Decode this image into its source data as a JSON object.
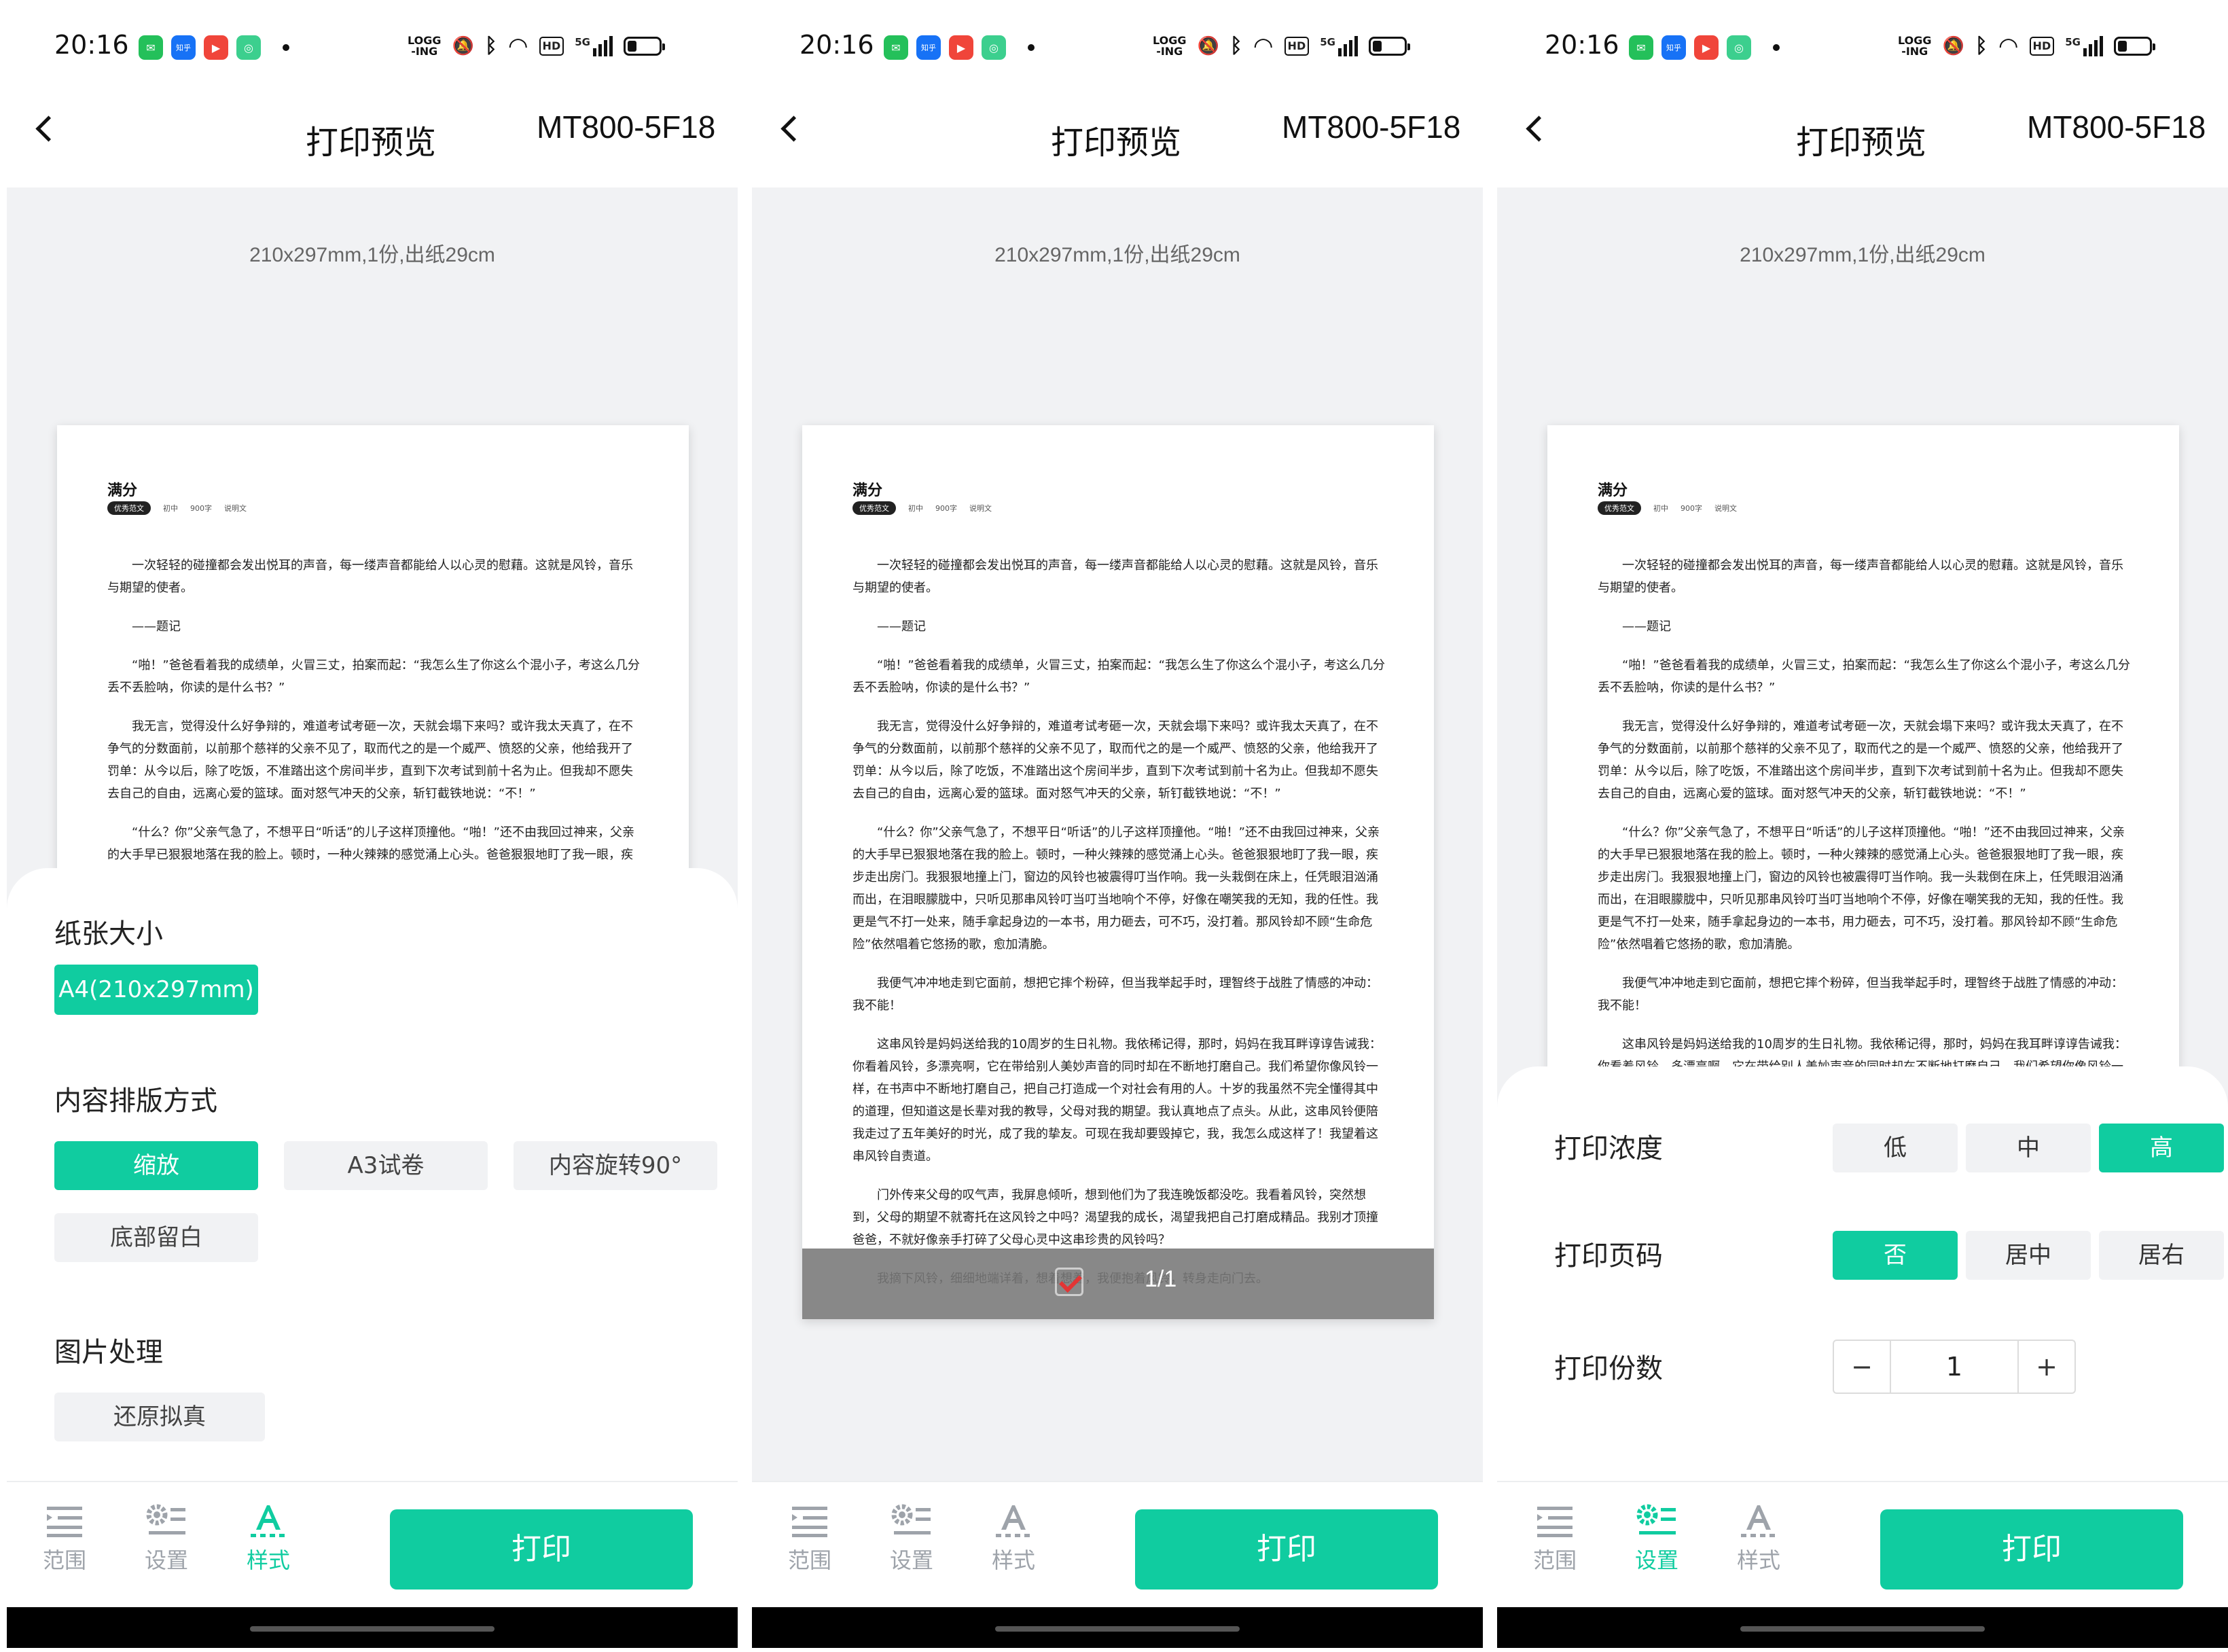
{
  "status_bar": {
    "time": "20:16",
    "app_icons": [
      {
        "name": "message-app-icon",
        "color": "#24c05a",
        "glyph": "✉"
      },
      {
        "name": "zhihu-app-icon",
        "color": "#1772f6",
        "glyph": "知乎"
      },
      {
        "name": "video-app-icon",
        "color": "#f0453a",
        "glyph": "▶"
      },
      {
        "name": "green-app-icon",
        "color": "#3ccf8e",
        "glyph": "◎"
      }
    ],
    "log_label": "LOGG\n-ING",
    "hd_label": "HD",
    "network_label": "5G",
    "battery_percent": 30
  },
  "header": {
    "title": "打印预览",
    "printer_name": "MT800-5F18"
  },
  "preview": {
    "paper_info": "210x297mm,1份,出纸29cm",
    "document": {
      "title": "满分",
      "tags": [
        "优秀范文",
        "初中",
        "900字",
        "说明文"
      ],
      "paragraphs": [
        "一次轻轻的碰撞都会发出悦耳的声音，每一缕声音都能给人以心灵的慰藉。这就是风铃，音乐与期望的使者。",
        "——题记",
        "“啪！”爸爸看着我的成绩单，火冒三丈，拍案而起：“我怎么生了你这么个混小子，考这么几分丢不丢脸呐，你读的是什么书？”",
        "我无言，觉得没什么好争辩的，难道考试考砸一次，天就会塌下来吗？或许我太天真了，在不争气的分数面前，以前那个慈祥的父亲不见了，取而代之的是一个威严、愤怒的父亲，他给我开了罚单：从今以后，除了吃饭，不准踏出这个房间半步，直到下次考试到前十名为止。但我却不愿失去自己的自由，远离心爱的篮球。面对怒气冲天的父亲，斩钉截铁地说：“不！”",
        "“什么？你”父亲气急了，不想平日“听话”的儿子这样顶撞他。“啪！”还不由我回过神来，父亲的大手早已狠狠地落在我的脸上。顿时，一种火辣辣的感觉涌上心头。爸爸狠狠地盯了我一眼，疾步走出房门。我狠狠地撞上门，窗边的风铃也被震得叮当作响。我一头栽倒在床上，任凭眼泪汹涌而出，在泪眼朦胧中，只听见那串风铃叮当叮当地响个不停，好像在嘲笑我的无知，我的任性。我更是气不打一处来，随手拿起身边的一本书，用力砸去，可不巧，没打着。那风铃却不顾“生命危险”依然唱着它悠扬的歌，愈加清脆。",
        "我便气冲冲地走到它面前，想把它摔个粉碎，但当我举起手时，理智终于战胜了情感的冲动：我不能！",
        "这串风铃是妈妈送给我的10周岁的生日礼物。我依稀记得，那时，妈妈在我耳畔谆谆告诫我：你看着风铃，多漂亮啊，它在带给别人美妙声音的同时却在不断地打磨自己。我们希望你像风铃一样，在书声中不断地打磨自己，把自己打造成一个对社会有用的人。十岁的我虽然不完全懂得其中的道理，但知道这是长辈对我的教导，父母对我的期望。我认真地点了点头。从此，这串风铃便陪我走过了五年美好的时光，成了我的挚友。可现在我却要毁掉它，我，我怎么成这样了！我望着这串风铃自责道。",
        "门外传来父母的叹气声，我屏息倾听，想到他们为了我连晚饭都没吃。我看着风铃，突然想到，父母的期望不就寄托在这风铃之中吗？渴望我的成长，渴望我把自己打磨成精品。我别才顶撞爸爸，不就好像亲手打碎了父母心灵中这串珍贵的风铃吗？",
        "我摘下风铃，细细地端详着，想着想着，我便抱着风铃，转身走向门去。"
      ],
      "page_indicator": "1/1"
    }
  },
  "style_sheet": {
    "paper_size_label": "纸张大小",
    "paper_size_options": [
      "A4(210x297mm)"
    ],
    "paper_size_selected": "A4(210x297mm)",
    "layout_label": "内容排版方式",
    "layout_options": [
      "缩放",
      "A3试卷",
      "内容旋转90°",
      "底部留白"
    ],
    "layout_selected": "缩放",
    "image_label": "图片处理",
    "image_options": [
      "还原拟真"
    ]
  },
  "settings_sheet": {
    "density_label": "打印浓度",
    "density_options": [
      "低",
      "中",
      "高"
    ],
    "density_selected": "高",
    "page_number_label": "打印页码",
    "page_number_options": [
      "否",
      "居中",
      "居右"
    ],
    "page_number_selected": "否",
    "copies_label": "打印份数",
    "copies_value": "1",
    "minus_label": "−",
    "plus_label": "+"
  },
  "bottom_nav": {
    "tabs": [
      {
        "label": "范围",
        "icon": "range-list-icon"
      },
      {
        "label": "设置",
        "icon": "settings-gear-icon"
      },
      {
        "label": "样式",
        "icon": "text-style-icon"
      }
    ],
    "print_button": "打印"
  },
  "panels": [
    {
      "active_tab": "样式",
      "mode": "style"
    },
    {
      "active_tab": "",
      "mode": "preview"
    },
    {
      "active_tab": "设置",
      "mode": "settings"
    }
  ],
  "colors": {
    "accent": "#10cca0",
    "chip_bg": "#f1f2f4",
    "preview_bg": "#f1f2f4",
    "inactive_icon": "#9ea3aa",
    "check_mark": "#e23535"
  }
}
